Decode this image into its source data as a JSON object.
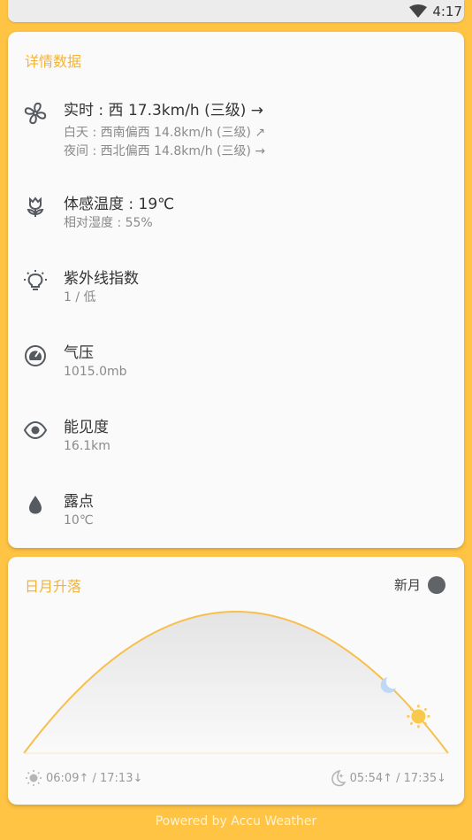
{
  "status": {
    "time": "4:17"
  },
  "details": {
    "title": "详情数据",
    "wind": {
      "main": "实时 : 西 17.3km/h (三级) →",
      "day": "白天 : 西南偏西 14.8km/h (三级) ↗",
      "night": "夜间 : 西北偏西 14.8km/h (三级) →"
    },
    "feels_like": {
      "main": "体感温度 : 19℃",
      "humidity": "相对湿度 : 55%"
    },
    "uv": {
      "main": "紫外线指数",
      "value": "1 / 低"
    },
    "pressure": {
      "main": "气压",
      "value": "1015.0mb"
    },
    "visibility": {
      "main": "能见度",
      "value": "16.1km"
    },
    "dew_point": {
      "main": "露点",
      "value": "10℃"
    }
  },
  "sun_moon": {
    "title": "日月升落",
    "moon_phase": "新月",
    "sun_times": "06:09↑ / 17:13↓",
    "moon_times": "05:54↑ / 17:35↓",
    "sun_progress": 0.93,
    "moon_progress": 0.86
  },
  "footer": "Powered by Accu Weather",
  "colors": {
    "accent": "#F5B333",
    "background": "#FFC443",
    "icon": "#555A60"
  },
  "icons": [
    "wifi-icon",
    "fan-icon",
    "flower-icon",
    "bulb-icon",
    "gauge-icon",
    "eye-icon",
    "drop-icon",
    "sun-icon",
    "moon-icon"
  ]
}
